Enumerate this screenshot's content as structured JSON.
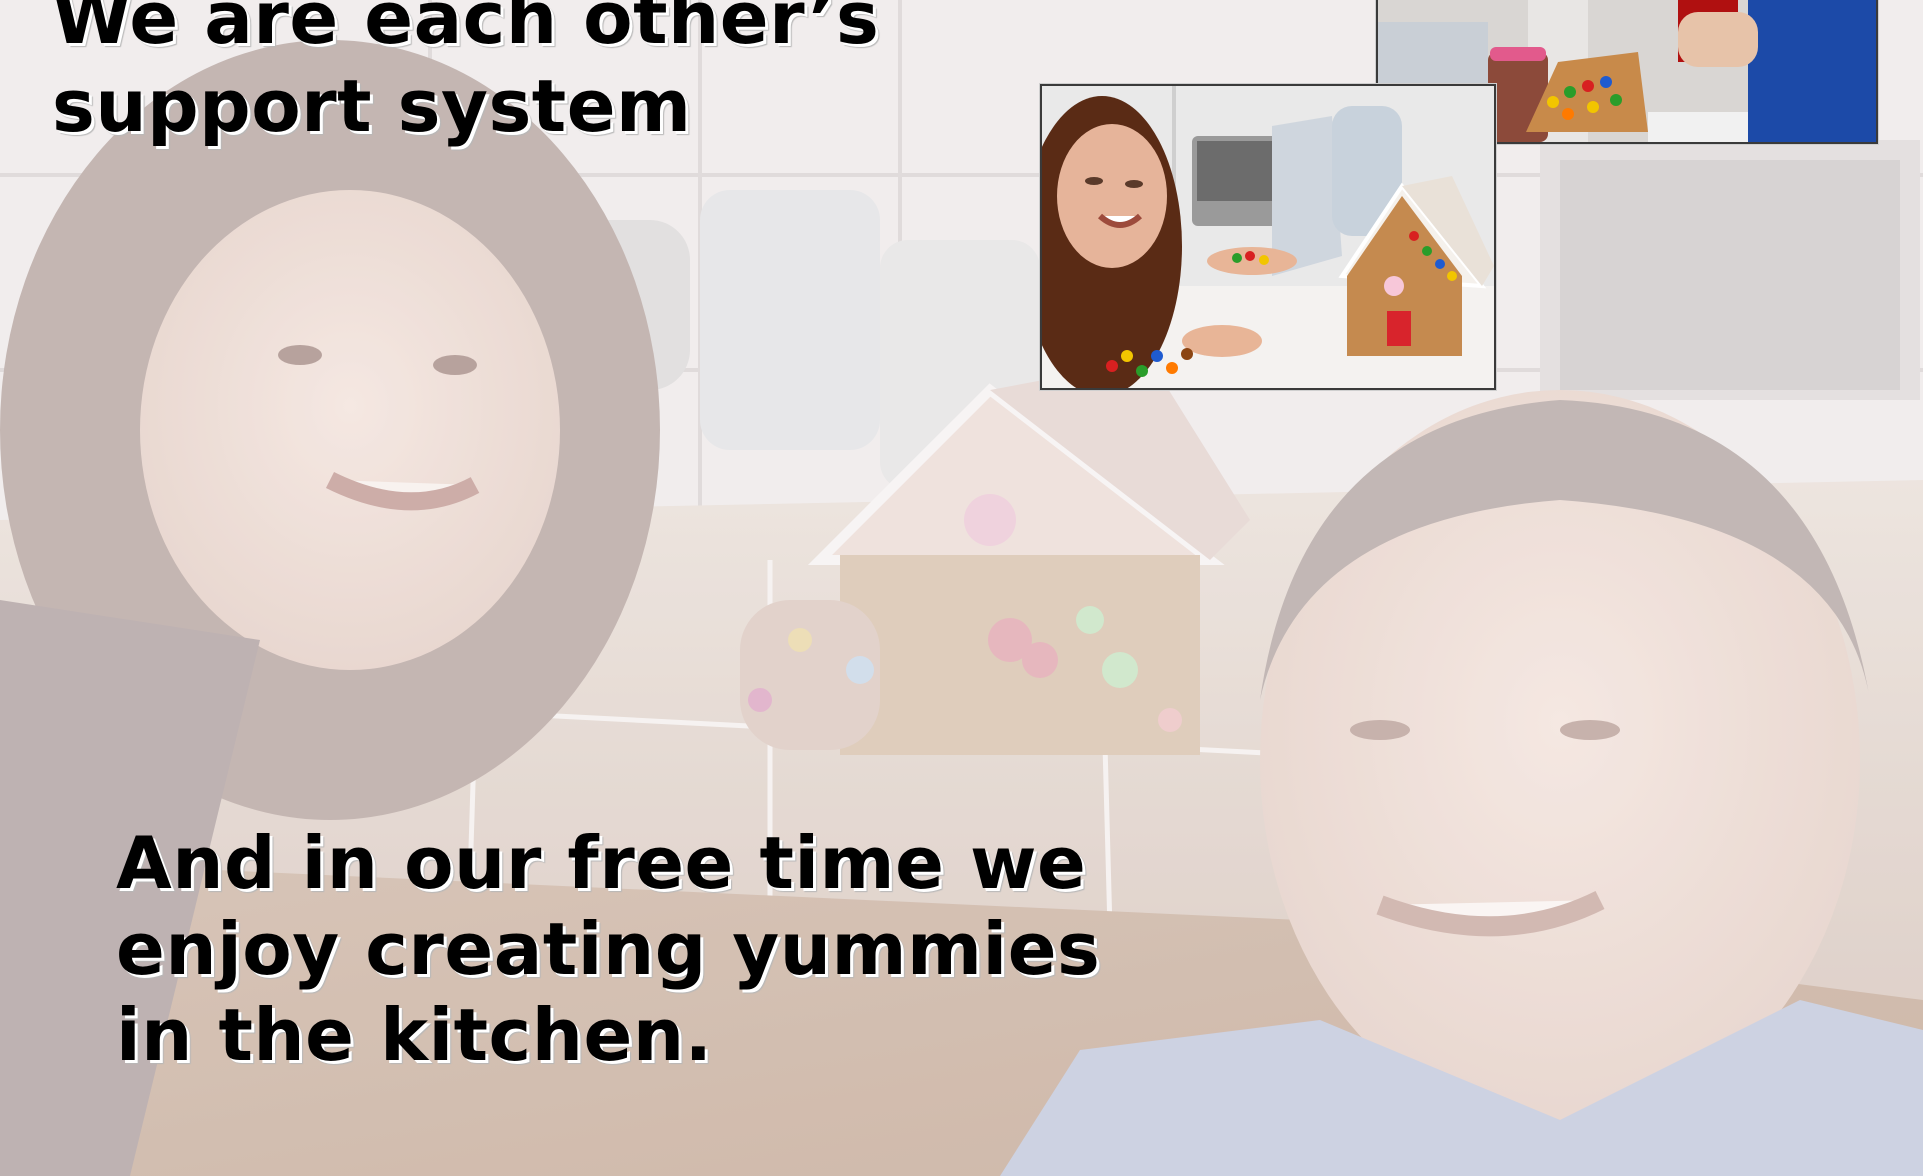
{
  "slide": {
    "caption_top": "We are each other’s\nsupport system",
    "caption_bottom": "And in our free time we\nenjoy creating yummies\nin the kitchen."
  },
  "photos": {
    "background": "couple smiling next to a decorated gingerbread house in a kitchen (washed-out)",
    "inset_top_right": "man in blue shirt decorating gingerbread house with candies",
    "inset_middle": "woman smiling holding candies beside a gingerbread house"
  }
}
